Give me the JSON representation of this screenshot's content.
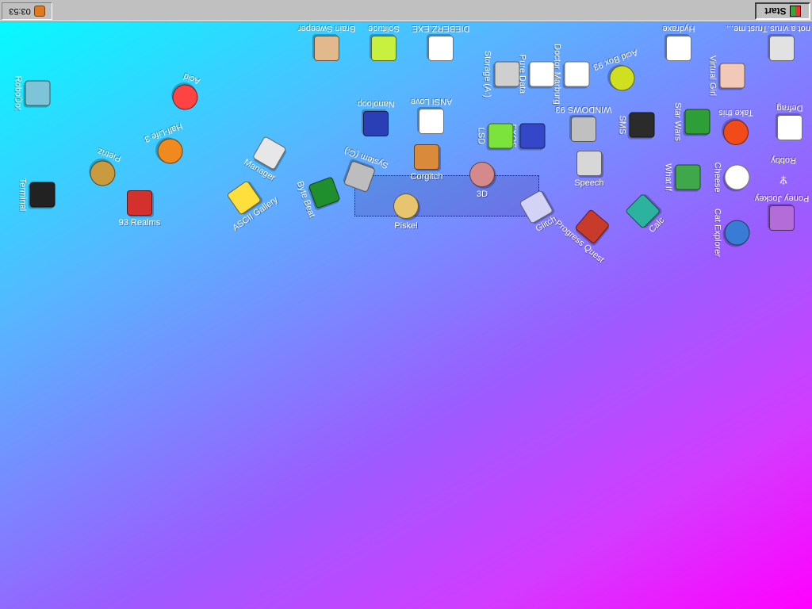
{
  "taskbar": {
    "clock": "03:53",
    "start_label": "Start"
  },
  "desktop": {
    "icons": {
      "nanoloop": "Nanoloop",
      "ansi_love": "ANSI Love",
      "corgitch": "Corgitch",
      "three_d": "3D",
      "piskel": "Piskel",
      "speech": "Speech",
      "windows93": "WINDOWS 93",
      "fxos": "FXOS",
      "system_c": "System (C:)",
      "byte_beat": "Byte Beat",
      "ascii_gallery": "ASCII Gallery",
      "realms": "93 Realms",
      "half_life": "Half-Life 3",
      "pietriz": "Pietriz",
      "acidbox": "Acid Box 93",
      "doctor_marburg": "Doctor Marburg",
      "pure_data": "Pure Data",
      "storage": "Storage (A:)",
      "dieberzexe": "DIEBERZ.EXE",
      "solitude": "Solitude",
      "brain_sweeper": "Brain Sweeper",
      "hydraxe": "Hydraxe",
      "virtual_girl": "Virtual Girl",
      "totally_not_virus": "Totally not a virus.Trust me...",
      "take_this": "Take this",
      "star_wars": "Star Wars",
      "sms": "SMS",
      "defrag": "Defrag",
      "what_if": "What If",
      "robby": "Robby",
      "poney_jockey": "Poney Jockey",
      "cat_explorer": "Cat Explorer",
      "cheese": "Cheese",
      "calc": "Calc",
      "progress_quest": "Progress Quest",
      "losing_alt": "Glitch",
      "terminal": "Terminal",
      "manager": "Manager",
      "robodot": "RoboDot",
      "lsd": "LSD",
      "acid": "Acid"
    },
    "colors": {
      "desktop_gradient_start": "#00ffff",
      "desktop_gradient_end": "#ff00ff",
      "taskbar": "#c0c0c0"
    }
  }
}
